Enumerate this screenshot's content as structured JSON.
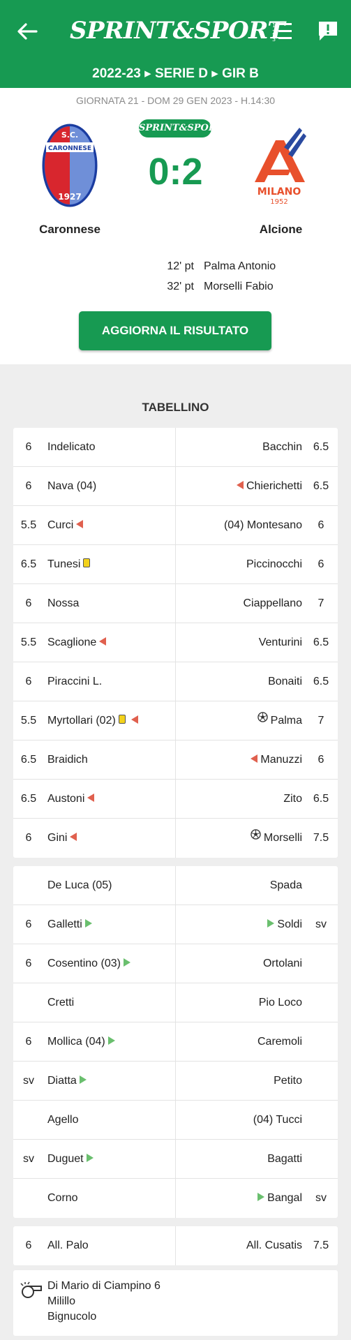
{
  "header": {
    "logo_text": "SPRINT&SPORT",
    "breadcrumb": "2022-23 ▸ SERIE D ▸ GIR B"
  },
  "match": {
    "info": "GIORNATA 21 - DOM 29 GEN 2023 - H.14:30",
    "badge": "SPRINT&SPORT",
    "score": "0:2",
    "home_team": "Caronnese",
    "away_team": "Alcione",
    "home_crest": {
      "top": "S.C.",
      "mid": "CARONNESE",
      "year": "1927"
    },
    "away_crest": {
      "city": "MILANO",
      "year": "1952"
    },
    "scorers": [
      {
        "minute": "12' pt",
        "name": "Palma Antonio"
      },
      {
        "minute": "32' pt",
        "name": "Morselli Fabio"
      }
    ],
    "update_button": "AGGIORNA IL RISULTATO"
  },
  "tabellino_title": "TABELLINO",
  "colors": {
    "brand": "#179a52",
    "sub_out": "#e0604e",
    "sub_in": "#6abf6e",
    "yellow_card": "#f3d21b"
  },
  "starters": [
    {
      "lg": "6",
      "ln": "Indelicato",
      "li": [],
      "rn": "Bacchin",
      "ri": [],
      "rg": "6.5"
    },
    {
      "lg": "6",
      "ln": "Nava (04)",
      "li": [],
      "rn": "Chierichetti",
      "ri": [
        "out"
      ],
      "rg": "6.5"
    },
    {
      "lg": "5.5",
      "ln": "Curci",
      "li": [
        "out"
      ],
      "rn": "(04) Montesano",
      "ri": [],
      "rg": "6"
    },
    {
      "lg": "6.5",
      "ln": "Tunesi",
      "li": [
        "yellow"
      ],
      "rn": "Piccinocchi",
      "ri": [],
      "rg": "6"
    },
    {
      "lg": "6",
      "ln": "Nossa",
      "li": [],
      "rn": "Ciappellano",
      "ri": [],
      "rg": "7"
    },
    {
      "lg": "5.5",
      "ln": "Scaglione",
      "li": [
        "out"
      ],
      "rn": "Venturini",
      "ri": [],
      "rg": "6.5"
    },
    {
      "lg": "6",
      "ln": "Piraccini L.",
      "li": [],
      "rn": "Bonaiti",
      "ri": [],
      "rg": "6.5"
    },
    {
      "lg": "5.5",
      "ln": "Myrtollari (02)",
      "li": [
        "yellow",
        "out"
      ],
      "rn": "Palma",
      "ri": [
        "ball"
      ],
      "rg": "7"
    },
    {
      "lg": "6.5",
      "ln": "Braidich",
      "li": [],
      "rn": "Manuzzi",
      "ri": [
        "out"
      ],
      "rg": "6"
    },
    {
      "lg": "6.5",
      "ln": "Austoni",
      "li": [
        "out"
      ],
      "rn": "Zito",
      "ri": [],
      "rg": "6.5"
    },
    {
      "lg": "6",
      "ln": "Gini",
      "li": [
        "out"
      ],
      "rn": "Morselli",
      "ri": [
        "ball"
      ],
      "rg": "7.5"
    }
  ],
  "bench": [
    {
      "lg": "",
      "ln": "De Luca (05)",
      "li": [],
      "rn": "Spada",
      "ri": [],
      "rg": ""
    },
    {
      "lg": "6",
      "ln": "Galletti",
      "li": [
        "in"
      ],
      "rn": "Soldi",
      "ri": [
        "in"
      ],
      "rg": "sv"
    },
    {
      "lg": "6",
      "ln": "Cosentino (03)",
      "li": [
        "in"
      ],
      "rn": "Ortolani",
      "ri": [],
      "rg": ""
    },
    {
      "lg": "",
      "ln": "Cretti",
      "li": [],
      "rn": "Pio Loco",
      "ri": [],
      "rg": ""
    },
    {
      "lg": "6",
      "ln": "Mollica (04)",
      "li": [
        "in"
      ],
      "rn": "Caremoli",
      "ri": [],
      "rg": ""
    },
    {
      "lg": "sv",
      "ln": "Diatta",
      "li": [
        "in"
      ],
      "rn": "Petito",
      "ri": [],
      "rg": ""
    },
    {
      "lg": "",
      "ln": "Agello",
      "li": [],
      "rn": "(04) Tucci",
      "ri": [],
      "rg": ""
    },
    {
      "lg": "sv",
      "ln": "Duguet",
      "li": [
        "in"
      ],
      "rn": "Bagatti",
      "ri": [],
      "rg": ""
    },
    {
      "lg": "",
      "ln": "Corno",
      "li": [],
      "rn": "Bangal",
      "ri": [
        "in"
      ],
      "rg": "sv"
    }
  ],
  "coaches": [
    {
      "lg": "6",
      "ln": "All. Palo",
      "li": [],
      "rn": "All. Cusatis",
      "ri": [],
      "rg": "7.5"
    }
  ],
  "referees": [
    "Di Mario di Ciampino 6",
    "Milillo",
    "Bignucolo"
  ]
}
